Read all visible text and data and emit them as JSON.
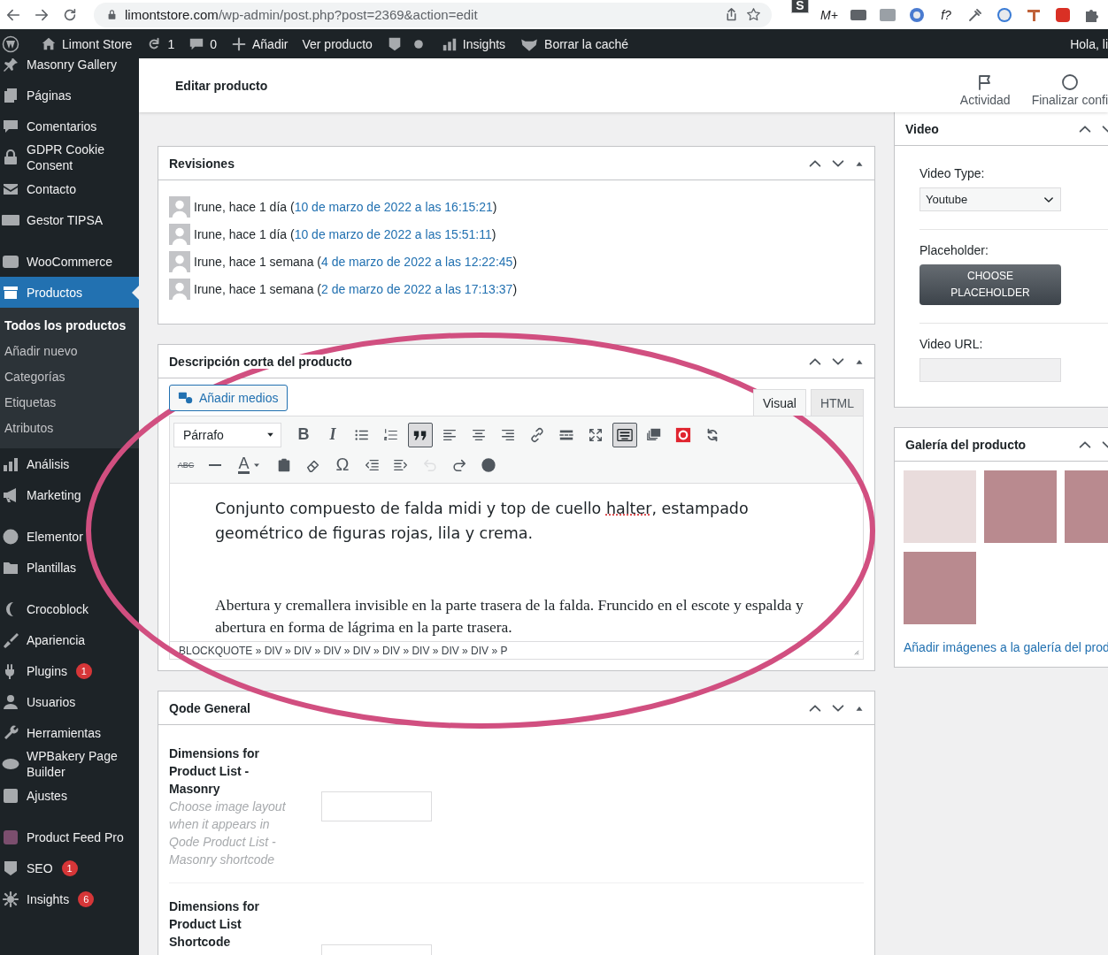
{
  "browser": {
    "url_host": "limontstore.com",
    "url_path": "/wp-admin/post.php?post=2369&action=edit",
    "extensions": [
      {
        "kind": "letter",
        "text": "S"
      },
      {
        "kind": "letter",
        "text": "M+"
      },
      {
        "kind": "icon"
      },
      {
        "kind": "icon"
      },
      {
        "kind": "icon"
      },
      {
        "kind": "letter",
        "text": "f?"
      },
      {
        "kind": "icon"
      },
      {
        "kind": "icon"
      },
      {
        "kind": "icon"
      },
      {
        "kind": "icon"
      },
      {
        "kind": "icon"
      }
    ]
  },
  "admin_bar": {
    "site": "Limont Store",
    "updates": "1",
    "comments": "0",
    "new": "Añadir",
    "view": "Ver producto",
    "insights": "Insights",
    "cache": "Borrar la caché",
    "greeting": "Hola, li"
  },
  "sidebar": {
    "groups": [
      [
        {
          "label": "Masonry Gallery",
          "selected": false
        },
        {
          "label": "Páginas",
          "selected": false
        },
        {
          "label": "Comentarios",
          "selected": false
        },
        {
          "label": "GDPR Cookie Consent",
          "selected": false
        },
        {
          "label": "Contacto",
          "selected": false
        },
        {
          "label": "Gestor TIPSA",
          "selected": false
        }
      ],
      [
        {
          "label": "WooCommerce",
          "selected": false
        },
        {
          "label": "Productos",
          "selected": true,
          "submenu": [
            {
              "label": "Todos los productos",
              "selected": true
            },
            {
              "label": "Añadir nuevo",
              "selected": false
            },
            {
              "label": "Categorías",
              "selected": false
            },
            {
              "label": "Etiquetas",
              "selected": false
            },
            {
              "label": "Atributos",
              "selected": false
            }
          ]
        },
        {
          "label": "Análisis",
          "selected": false
        },
        {
          "label": "Marketing",
          "selected": false
        }
      ],
      [
        {
          "label": "Elementor",
          "selected": false
        },
        {
          "label": "Plantillas",
          "selected": false
        }
      ],
      [
        {
          "label": "Crocoblock",
          "selected": false
        },
        {
          "label": "Apariencia",
          "selected": false
        },
        {
          "label": "Plugins",
          "selected": false,
          "badge": "1"
        },
        {
          "label": "Usuarios",
          "selected": false
        },
        {
          "label": "Herramientas",
          "selected": false
        },
        {
          "label": "WPBakery Page Builder",
          "selected": false
        },
        {
          "label": "Ajustes",
          "selected": false
        }
      ],
      [
        {
          "label": "Product Feed Pro",
          "selected": false
        },
        {
          "label": "SEO",
          "selected": false,
          "badge": "1"
        },
        {
          "label": "Insights",
          "selected": false,
          "badge": "6"
        }
      ]
    ]
  },
  "header": {
    "title": "Editar producto",
    "actions": [
      "Actividad",
      "Finalizar confi"
    ]
  },
  "revisions": {
    "title": "Revisiones",
    "rows": [
      {
        "text": "Irune, hace 1 día (",
        "link": "10 de marzo de 2022 a las 16:15:21",
        "after": ")"
      },
      {
        "text": "Irune, hace 1 día (",
        "link": "10 de marzo de 2022 a las 15:51:11",
        "after": ")"
      },
      {
        "text": "Irune, hace 1 semana (",
        "link": "4 de marzo de 2022 a las 12:22:45",
        "after": ")"
      },
      {
        "text": "Irune, hace 1 semana (",
        "link": "2 de marzo de 2022 a las 17:13:37",
        "after": ")"
      }
    ]
  },
  "description": {
    "title": "Descripción corta del producto",
    "add_media": "Añadir medios",
    "tabs": [
      {
        "label": "Visual",
        "selected": true
      },
      {
        "label": "HTML",
        "selected": false
      }
    ],
    "toolbar": [
      [
        {
          "kind": "dropdown",
          "value": "Párrafo"
        },
        {
          "kind": "glyph",
          "text": "B",
          "pressed": false,
          "disabled": false
        },
        {
          "kind": "glyph",
          "text": "I",
          "pressed": false,
          "disabled": false
        },
        {
          "kind": "icon",
          "pressed": false,
          "disabled": false
        },
        {
          "kind": "icon",
          "pressed": false,
          "disabled": false
        },
        {
          "kind": "icon",
          "pressed": true,
          "disabled": false
        },
        {
          "kind": "icon",
          "pressed": false,
          "disabled": false
        },
        {
          "kind": "icon",
          "pressed": false,
          "disabled": false
        },
        {
          "kind": "icon",
          "pressed": false,
          "disabled": false
        },
        {
          "kind": "icon",
          "pressed": false,
          "disabled": false
        },
        {
          "kind": "icon",
          "pressed": false,
          "disabled": false
        },
        {
          "kind": "icon",
          "pressed": false,
          "disabled": false
        },
        {
          "kind": "icon",
          "pressed": true,
          "disabled": false
        },
        {
          "kind": "icon",
          "pressed": false,
          "disabled": false
        },
        {
          "kind": "icon",
          "pressed": false,
          "disabled": false
        },
        {
          "kind": "icon",
          "pressed": false,
          "disabled": false
        }
      ],
      [
        {
          "kind": "strike",
          "text": "ABC",
          "pressed": false,
          "disabled": false
        },
        {
          "kind": "icon",
          "pressed": false,
          "disabled": false
        },
        {
          "kind": "textcolor",
          "text": "A",
          "pressed": false,
          "disabled": false
        },
        {
          "kind": "icon",
          "pressed": false,
          "disabled": false
        },
        {
          "kind": "icon",
          "pressed": false,
          "disabled": false
        },
        {
          "kind": "glyph",
          "text": "Ω",
          "pressed": false,
          "disabled": false
        },
        {
          "kind": "icon",
          "pressed": false,
          "disabled": false
        },
        {
          "kind": "icon",
          "pressed": false,
          "disabled": false
        },
        {
          "kind": "icon",
          "pressed": false,
          "disabled": true
        },
        {
          "kind": "icon",
          "pressed": false,
          "disabled": false
        },
        {
          "kind": "icon",
          "pressed": false,
          "disabled": false
        }
      ]
    ],
    "paragraphs": [
      {
        "kind": "sans",
        "segments": [
          {
            "text": "Conjunto compuesto de falda midi y top de cuello ",
            "misspelled": false
          },
          {
            "text": "halter",
            "misspelled": true
          },
          {
            "text": ", estampado geométrico de figuras rojas, lila y crema.",
            "misspelled": false
          }
        ]
      },
      {
        "kind": "serif",
        "segments": [
          {
            "text": "Abertura y cremallera invisible en la parte trasera de la falda. Fruncido en el escote y espalda y abertura en forma de lágrima en la parte trasera.",
            "misspelled": false
          }
        ]
      }
    ],
    "path": "BLOCKQUOTE » DIV » DIV » DIV » DIV » DIV » DIV » DIV » DIV » P"
  },
  "qode": {
    "title": "Qode General",
    "fields": [
      {
        "label": "Dimensions for Product List - Masonry",
        "description": "Choose image layout when it appears in Qode Product List - Masonry shortcode"
      },
      {
        "label": "Dimensions for Product List Shortcode"
      }
    ]
  },
  "video_box": {
    "title": "Video",
    "fields": [
      {
        "kind": "select",
        "label": "Video Type:",
        "value": "Youtube"
      },
      {
        "kind": "button",
        "label": "Placeholder:",
        "button": "CHOOSE PLACEHOLDER"
      },
      {
        "kind": "input",
        "label": "Video URL:"
      }
    ]
  },
  "gallery": {
    "title": "Galería del producto",
    "photos": [
      {
        "kind": "photo"
      },
      {
        "kind": "photo"
      },
      {
        "kind": "photo"
      },
      {
        "kind": "photo"
      }
    ],
    "link": "Añadir imágenes a la galería del prod"
  },
  "annotations": [
    {
      "kind": "ellipse"
    }
  ]
}
